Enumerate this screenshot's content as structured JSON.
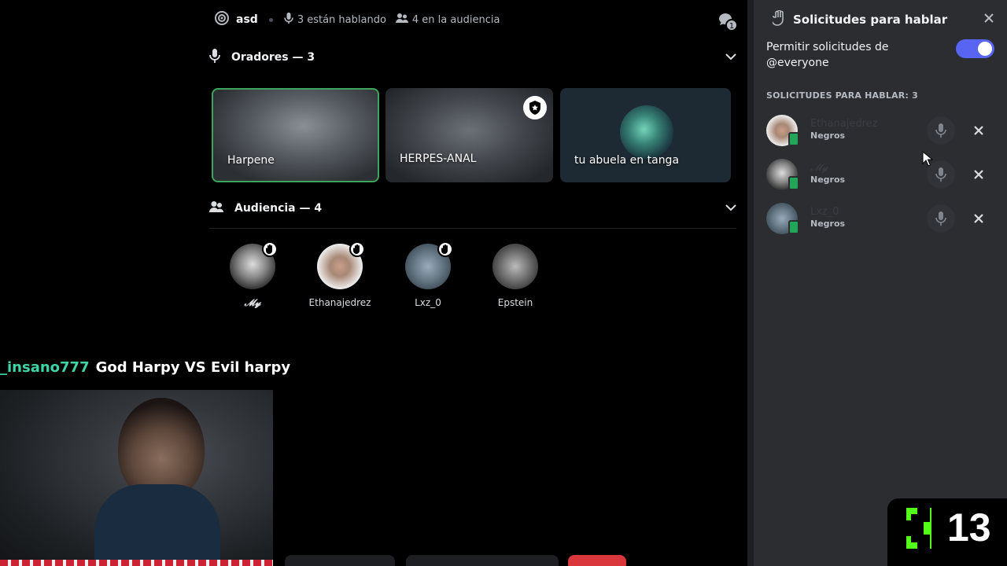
{
  "stage": {
    "title": "asd",
    "speaking_text": "3 están hablando",
    "audience_text": "4 en la audiencia",
    "threads_badge": "1",
    "speakers_header": "Oradores — 3",
    "audience_header": "Audiencia — 4",
    "speakers": [
      {
        "name": "Harpene",
        "speaking": true
      },
      {
        "name": "HERPES-ANAL",
        "moderator": true
      },
      {
        "name": "tu abuela en tanga"
      }
    ],
    "audience": [
      {
        "name": "𝓜𝔂",
        "hand_raised": true
      },
      {
        "name": "Ethanajedrez",
        "hand_raised": true
      },
      {
        "name": "Lxz_0",
        "hand_raised": true
      },
      {
        "name": "Epstein",
        "hand_raised": false
      }
    ]
  },
  "overlay": {
    "chat_user": "_insano777",
    "chat_message": "God Harpy VS Evil harpy",
    "kick_viewers": "13"
  },
  "panel": {
    "title": "Solicitudes para hablar",
    "allow_label": "Permitir solicitudes de @everyone",
    "allow_enabled": true,
    "requests_header": "SOLICITUDES PARA HABLAR: 3",
    "requests": [
      {
        "name": "Ethanajedrez",
        "role": "Negros"
      },
      {
        "name": "𝓜𝔂",
        "role": "Negros"
      },
      {
        "name": "Lxz_0",
        "role": "Negros"
      }
    ]
  },
  "colors": {
    "accent": "#5865f2",
    "speaking_ring": "#3ba55d",
    "kick_green": "#53fc18",
    "chat_user": "#3fd4a8"
  }
}
